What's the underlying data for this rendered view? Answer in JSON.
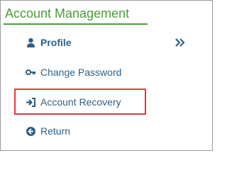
{
  "panel": {
    "title": "Account Management"
  },
  "menu": {
    "items": [
      {
        "label": "Profile",
        "icon": "user-icon",
        "active": true
      },
      {
        "label": "Change Password",
        "icon": "key-icon"
      },
      {
        "label": "Account Recovery",
        "icon": "sign-in-icon",
        "highlighted": true
      },
      {
        "label": "Return",
        "icon": "arrow-left-circle-icon"
      }
    ],
    "expand_icon": "double-chevron-right-icon"
  },
  "colors": {
    "heading": "#4e9a3b",
    "link": "#2d5f86",
    "highlight": "#e0393e",
    "border": "#9a9a9a"
  }
}
